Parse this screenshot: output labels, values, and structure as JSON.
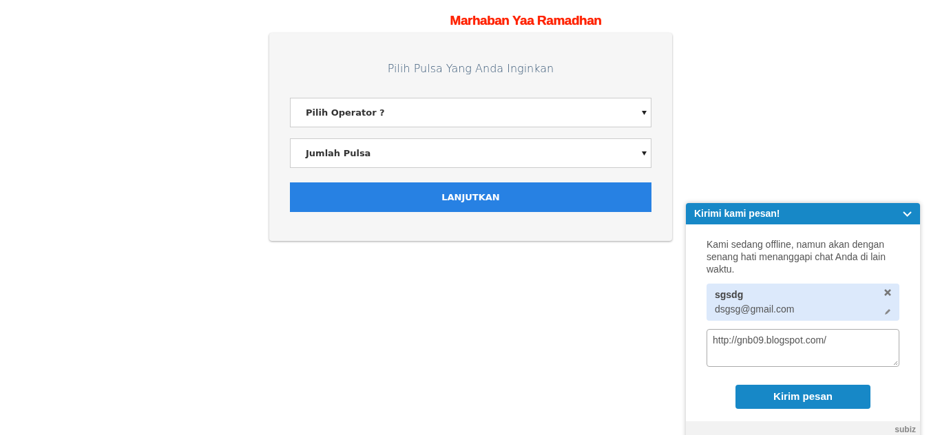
{
  "banner": "Marhaban Yaa Ramadhan",
  "form": {
    "title": "Pilih Pulsa Yang Anda Inginkan",
    "selects": [
      {
        "value": "Pilih Operator ?"
      },
      {
        "value": "Jumlah Pulsa"
      }
    ],
    "button": "LANJUTKAN"
  },
  "chat": {
    "title": "Kirimi kami pesan!",
    "message": "Kami sedang offline, namun akan dengan senang hati menanggapi chat Anda di lain waktu.",
    "contact": {
      "name": "sgsdg",
      "email": "dsgsg@gmail.com"
    },
    "textarea": "http://gnb09.blogspot.com/",
    "button": "Kirim pesan",
    "brand": "subiz"
  }
}
